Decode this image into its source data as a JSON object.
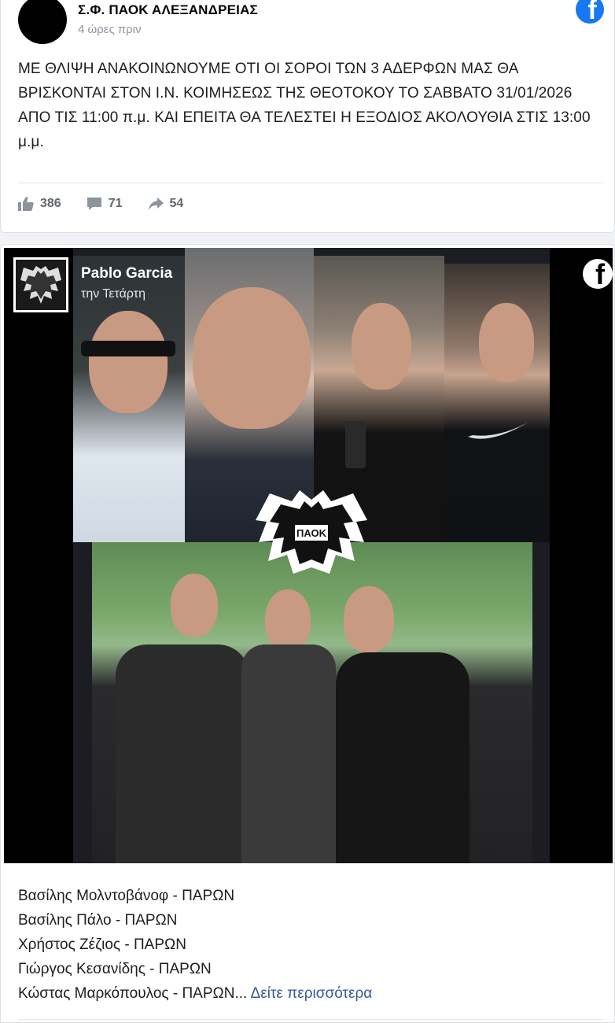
{
  "post1": {
    "page_name": "Σ.Φ. ΠΑΟΚ ΑΛΕΞΑΝΔΡΕΙΑΣ",
    "time": "4 ώρες πριν",
    "text": "ΜΕ ΘΛΙΨΗ ΑΝΑΚΟΙΝΩΝΟΥΜΕ ΟΤΙ ΟΙ ΣΟΡΟΙ ΤΩΝ 3 ΑΔΕΡΦΩΝ ΜΑΣ ΘΑ ΒΡΙΣΚΟΝΤΑΙ ΣΤΟΝ Ι.Ν. ΚΟΙΜΗΣΕΩΣ ΤΗΣ ΘΕΟΤΟΚΟΥ ΤΟ ΣΑΒΒΑΤΟ 31/01/2026 ΑΠΟ ΤΙΣ 11:00 π.μ. ΚΑΙ ΕΠΕΙΤΑ ΘΑ ΤΕΛΕΣΤΕΙ Η ΕΞΟΔΙΟΣ ΑΚΟΛΟΥΘΙΑ ΣΤΙΣ 13:00 μ.μ.",
    "likes": "386",
    "comments": "71",
    "shares": "54"
  },
  "post2": {
    "author": "Pablo Garcia",
    "time": "την Τετάρτη",
    "emblem_text": "ΠΑΟΚ",
    "names": [
      "Βασίλης Μολντοβάνοφ - ΠΑΡΩΝ",
      "Βασίλης Πάλο - ΠΑΡΩΝ",
      "Χρήστος Ζέζιος - ΠΑΡΩΝ",
      "Γιώργος Κεσανίδης - ΠΑΡΩΝ",
      "Κώστας Μαρκόπουλος - ΠΑΡΩΝ..."
    ],
    "see_more": "Δείτε περισσότερα"
  },
  "icons": {
    "like": "thumbs-up-icon",
    "comment": "comment-icon",
    "share": "share-icon",
    "brand": "facebook-icon"
  },
  "colors": {
    "facebook_blue": "#1877f2",
    "link": "#385898",
    "meta_text": "#606770"
  }
}
